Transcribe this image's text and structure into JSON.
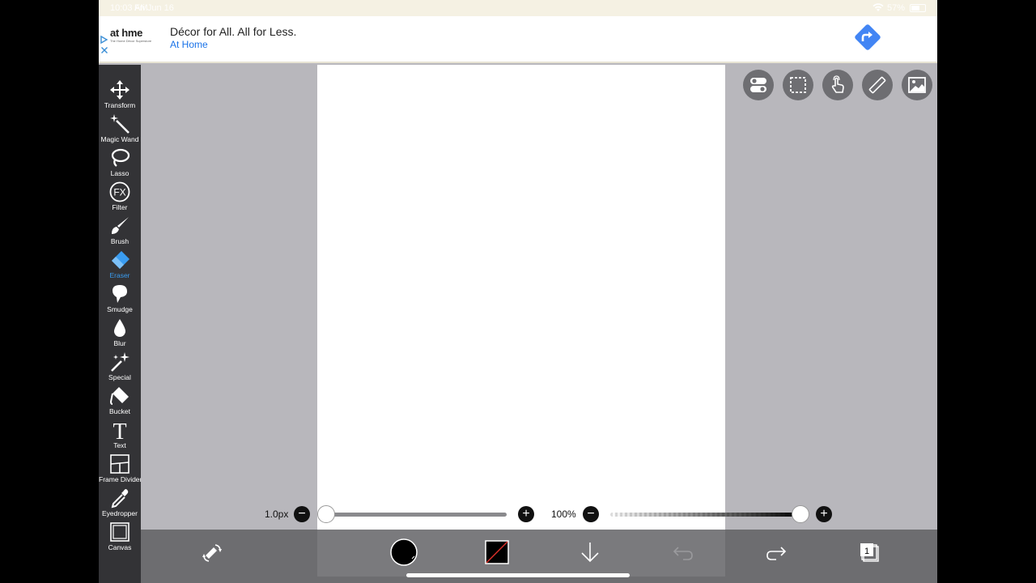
{
  "status_bar": {
    "time": "10:03 AM",
    "date": "Fri Jun 16",
    "battery": "57%"
  },
  "ad": {
    "logo_text_a": "at h",
    "logo_text_b": "me",
    "logo_tag": "The Home Décor Superstore",
    "headline": "Décor for All. All for Less.",
    "advertiser": "At Home",
    "cta_icon": "directions-icon",
    "adchoices_icon": "adchoices-icon",
    "close_icon": "close-icon"
  },
  "tools": [
    {
      "label": "Transform",
      "icon": "move-arrows-icon",
      "active": false
    },
    {
      "label": "Magic Wand",
      "icon": "magic-wand-icon",
      "active": false
    },
    {
      "label": "Lasso",
      "icon": "lasso-icon",
      "active": false
    },
    {
      "label": "Filter",
      "icon": "fx-icon",
      "active": false
    },
    {
      "label": "Brush",
      "icon": "brush-icon",
      "active": false
    },
    {
      "label": "Eraser",
      "icon": "eraser-icon",
      "active": true
    },
    {
      "label": "Smudge",
      "icon": "smudge-icon",
      "active": false
    },
    {
      "label": "Blur",
      "icon": "drop-icon",
      "active": false
    },
    {
      "label": "Special",
      "icon": "sparkle-icon",
      "active": false
    },
    {
      "label": "Bucket",
      "icon": "bucket-icon",
      "active": false
    },
    {
      "label": "Text",
      "icon": "text-icon",
      "active": false
    },
    {
      "label": "Frame Divider",
      "icon": "frame-divider-icon",
      "active": false
    },
    {
      "label": "Eyedropper",
      "icon": "eyedropper-icon",
      "active": false
    },
    {
      "label": "Canvas",
      "icon": "canvas-icon",
      "active": false
    }
  ],
  "filter_icon_text": "FX",
  "text_icon_text": "T",
  "top_buttons": [
    "toggle-icon",
    "selection-icon",
    "touch-icon",
    "ruler-icon",
    "image-icon"
  ],
  "sliders": {
    "size_label": "1.0px",
    "size_value_fraction": 0.0,
    "opacity_label": "100%",
    "opacity_value_fraction": 1.0,
    "minus": "−",
    "plus": "+"
  },
  "bottom_bar": {
    "layers_count": "1",
    "icons": [
      "swap-tools-icon",
      "color-swatch-icon",
      "secondary-color-icon",
      "download-icon",
      "undo-icon",
      "redo-icon",
      "layers-icon",
      "back-arrow-icon"
    ]
  },
  "colors": {
    "toolbar_bg": "#333336",
    "workspace_bg": "#b8b7bc",
    "accent_active": "#3a9cf0",
    "bottom_bar_bg": "#6d6d70",
    "ad_link": "#1a73e8",
    "ad_cta": "#4285f4"
  }
}
